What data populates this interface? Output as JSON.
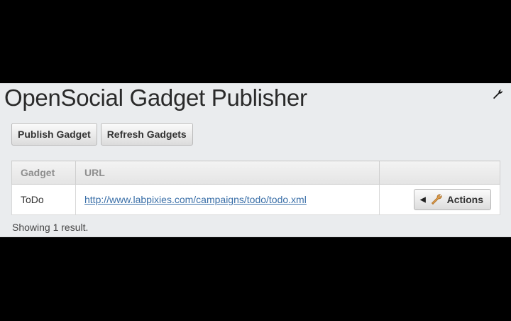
{
  "header": {
    "title": "OpenSocial Gadget Publisher"
  },
  "toolbar": {
    "publish_label": "Publish Gadget",
    "refresh_label": "Refresh Gadgets"
  },
  "table": {
    "columns": [
      "Gadget",
      "URL",
      ""
    ],
    "rows": [
      {
        "gadget": "ToDo",
        "url": "http://www.labpixies.com/campaigns/todo/todo.xml",
        "action_label": "Actions"
      }
    ]
  },
  "status": "Showing 1 result.",
  "colors": {
    "panel_bg": "#eaecee",
    "link": "#3a6fa8",
    "wrench_accent": "#d98a2b"
  },
  "icons": {
    "config": "wrench-icon",
    "actions_menu": "triangle-left-icon",
    "actions": "wrench-icon"
  }
}
